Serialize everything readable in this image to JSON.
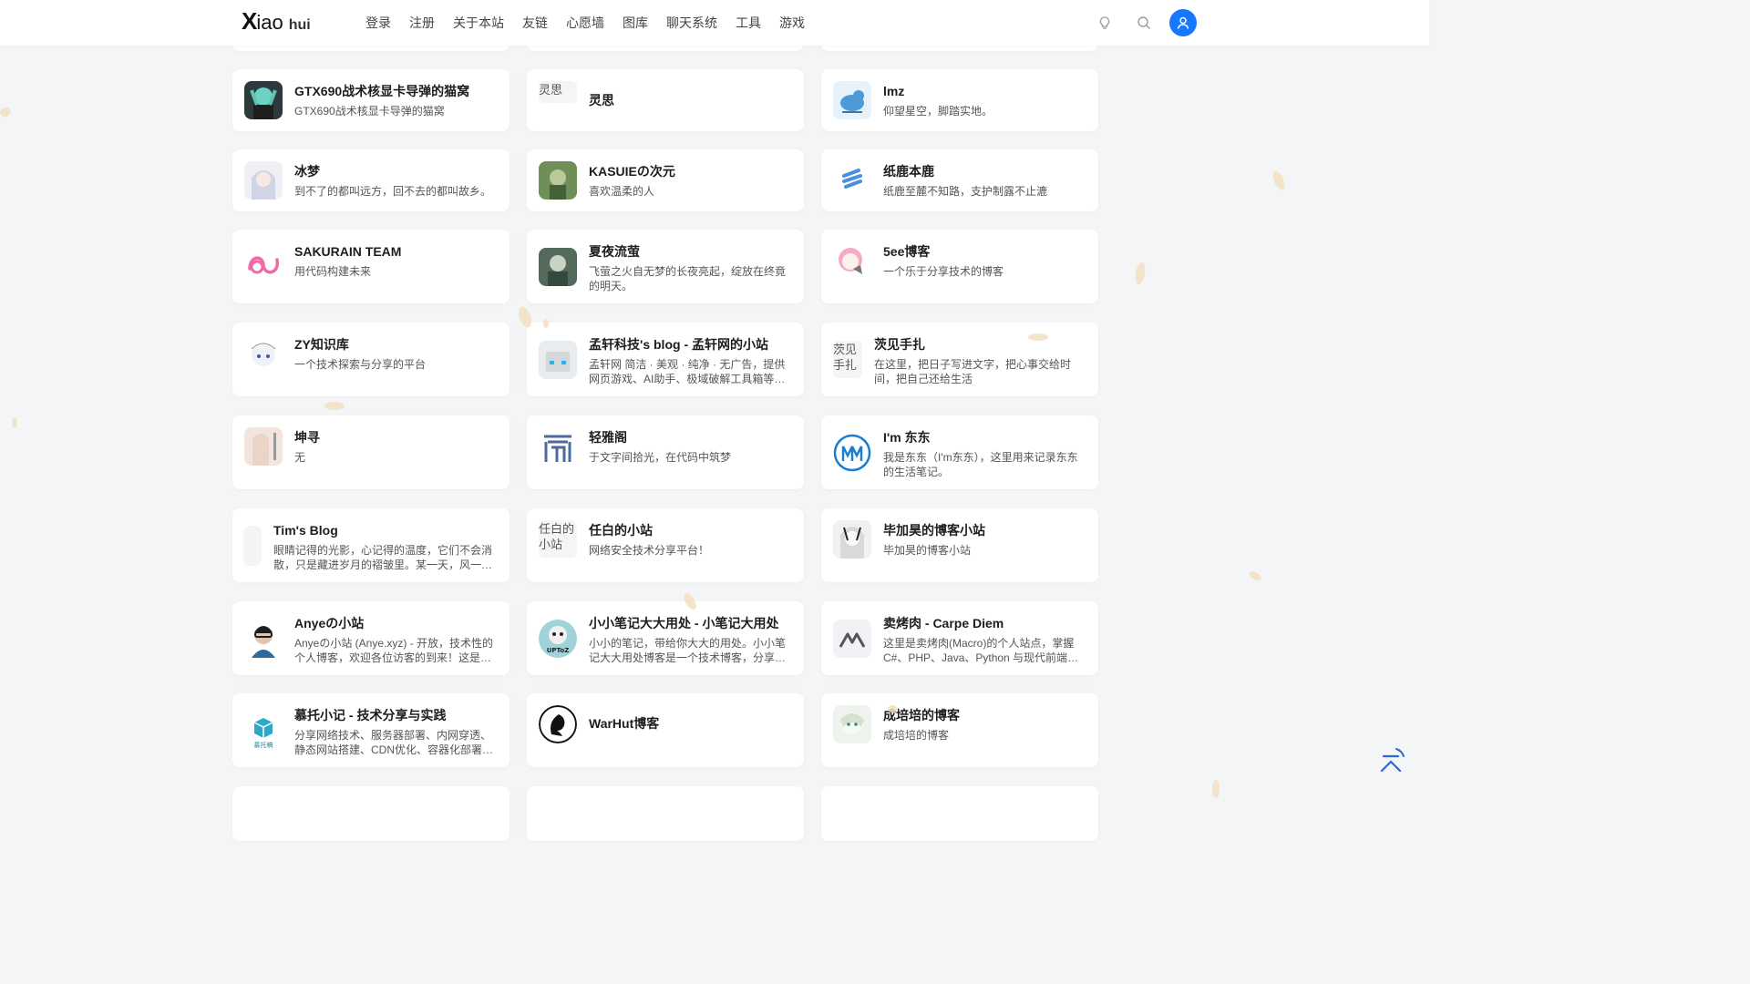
{
  "header": {
    "logo_x": "X",
    "logo_iao": "iao",
    "logo_hui": "hui",
    "nav": [
      "登录",
      "注册",
      "关于本站",
      "友链",
      "心愿墙",
      "图库",
      "聊天系统",
      "工具",
      "游戏"
    ]
  },
  "colors": {
    "accent": "#1677ff",
    "background": "#f4f5f7",
    "card": "#ffffff"
  },
  "icons": {
    "theme": "lightbulb-icon",
    "search": "search-icon",
    "user": "user-icon",
    "back_to_top": "back-to-top-icon"
  },
  "links": [
    {
      "name": "GTX690战术核显卡导弹的猫窝",
      "desc": "GTX690战术核显卡导弹的猫窝"
    },
    {
      "name": "灵思",
      "desc": "",
      "alt": "灵思"
    },
    {
      "name": "lmz",
      "desc": "仰望星空，脚踏实地。"
    },
    {
      "name": "冰梦",
      "desc": "到不了的都叫远方，回不去的都叫故乡。"
    },
    {
      "name": "KASUIEの次元",
      "desc": "喜欢温柔的人"
    },
    {
      "name": "纸鹿本鹿",
      "desc": "纸鹿至麓不知路，支护制露不止漉"
    },
    {
      "name": "SAKURAIN TEAM",
      "desc": "用代码构建未来"
    },
    {
      "name": "夏夜流萤",
      "desc": "飞萤之火自无梦的长夜亮起，绽放在终竟的明天。"
    },
    {
      "name": "5ee博客",
      "desc": "一个乐于分享技术的博客"
    },
    {
      "name": "ZY知识库",
      "desc": "一个技术探索与分享的平台"
    },
    {
      "name": "孟轩科技's blog - 孟轩网的小站",
      "desc": "孟轩网 简洁 · 美观 · 纯净 · 无广告，提供网页游戏、AI助手、极域破解工具箱等多项..."
    },
    {
      "name": "茨见手扎",
      "desc": "在这里，把日子写进文字，把心事交给时间，把自己还给生活",
      "alt": "茨见手扎"
    },
    {
      "name": "坤寻",
      "desc": "无"
    },
    {
      "name": "轻雅阁",
      "desc": "于文字间拾光，在代码中筑梦"
    },
    {
      "name": "I'm 东东",
      "desc": "我是东东（I'm东东），这里用来记录东东的生活笔记。"
    },
    {
      "name": "Tim's Blog",
      "desc": "眼睛记得的光影，心记得的温度，它们不会消散，只是藏进岁月的褶皱里。某一天，风一吹..."
    },
    {
      "name": "任白的小站",
      "desc": "网络安全技术分享平台！",
      "alt": "任白的小站"
    },
    {
      "name": "毕加昊的博客小站",
      "desc": "毕加昊的博客小站"
    },
    {
      "name": "Anyeの小站",
      "desc": "Anyeの小站 (Anye.xyz) - 开放，技术性的个人博客，欢迎各位访客的到来！这是一个..."
    },
    {
      "name": "小小笔记大大用处 - 小笔记大用处",
      "desc": "小小的笔记，带给你大大的用处。小小笔记大大用处博客是一个技术博客，分享关于..."
    },
    {
      "name": "卖烤肉 - Carpe Diem",
      "desc": "这里是卖烤肉(Macro)的个人站点，掌握 C#、PHP、Java、Python 与现代前端等..."
    },
    {
      "name": "慕托小记 - 技术分享与实践",
      "desc": "分享网络技术、服务器部署、内网穿透、静态网站搭建、CDN优化、容器化部署等技..."
    },
    {
      "name": "WarHut博客",
      "desc": ""
    },
    {
      "name": "成培培的博客",
      "desc": "成培培的博客"
    }
  ],
  "avatar_text": {
    "uptoz": "UPToZ",
    "muto": "慕托稿"
  }
}
